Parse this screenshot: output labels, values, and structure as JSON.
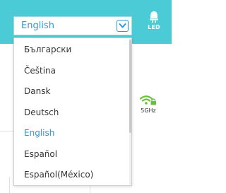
{
  "header": {
    "language_select": {
      "value": "English"
    },
    "led": {
      "label": "LED",
      "icon": "led-bulb-icon"
    }
  },
  "language_dropdown": {
    "options": [
      "Български",
      "Čeština",
      "Dansk",
      "Deutsch",
      "English",
      "Español",
      "Español(México)"
    ],
    "selected": "English"
  },
  "background": {
    "wifi_band": {
      "label": "5GHz",
      "icon": "wifi-locked-icon"
    }
  },
  "colors": {
    "header_bg": "#4acbd6",
    "accent": "#2a9ad6",
    "wifi_green": "#6cbf3a"
  }
}
